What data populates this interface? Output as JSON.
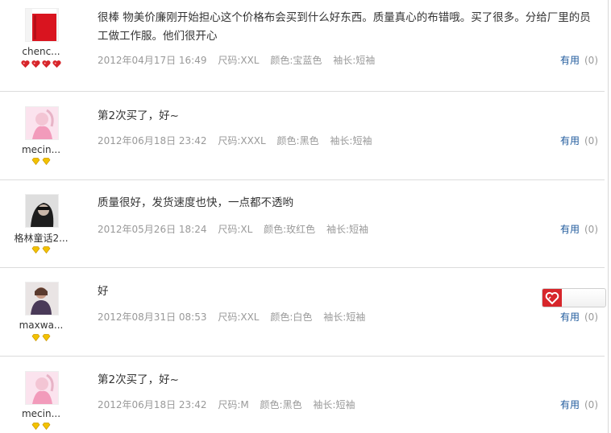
{
  "reviews": [
    {
      "username": "chenc...",
      "badge_type": "heart",
      "badge_count": 4,
      "text": "很棒 物美价廉刚开始担心这个价格布会买到什么好东西。质量真心的布错哦。买了很多。分给厂里的员工做工作服。他们很开心",
      "date": "2012年04月17日 16:49",
      "size": "尺码:XXL",
      "color": "颜色:宝蓝色",
      "sleeve": "袖长:短袖",
      "useful_label": "有用",
      "useful_count": "(0)"
    },
    {
      "username": "mecin...",
      "badge_type": "diamond",
      "badge_count": 2,
      "text": "第2次买了，好~",
      "date": "2012年06月18日 23:42",
      "size": "尺码:XXXL",
      "color": "颜色:黑色",
      "sleeve": "袖长:短袖",
      "useful_label": "有用",
      "useful_count": "(0)"
    },
    {
      "username": "格林童话2...",
      "badge_type": "diamond",
      "badge_count": 2,
      "text": "质量很好，发货速度也快，一点都不透哟",
      "date": "2012年05月26日 18:24",
      "size": "尺码:XL",
      "color": "颜色:玫红色",
      "sleeve": "袖长:短袖",
      "useful_label": "有用",
      "useful_count": "(0)"
    },
    {
      "username": "maxwa...",
      "badge_type": "diamond",
      "badge_count": 2,
      "text": "好",
      "date": "2012年08月31日 08:53",
      "size": "尺码:XXL",
      "color": "颜色:白色",
      "sleeve": "袖长:短袖",
      "useful_label": "有用",
      "useful_count": "(0)"
    },
    {
      "username": "mecin...",
      "badge_type": "diamond",
      "badge_count": 2,
      "text": "第2次买了，好~",
      "date": "2012年06月18日 23:42",
      "size": "尺码:M",
      "color": "颜色:黑色",
      "sleeve": "袖长:短袖",
      "useful_label": "有用",
      "useful_count": "(0)"
    }
  ],
  "colors": {
    "useful_link": "#1f5a9c",
    "meta_text": "#999999",
    "divider": "#dcdcdc",
    "heart_badge": "#d7262b",
    "diamond_badge": "#f2c200"
  }
}
